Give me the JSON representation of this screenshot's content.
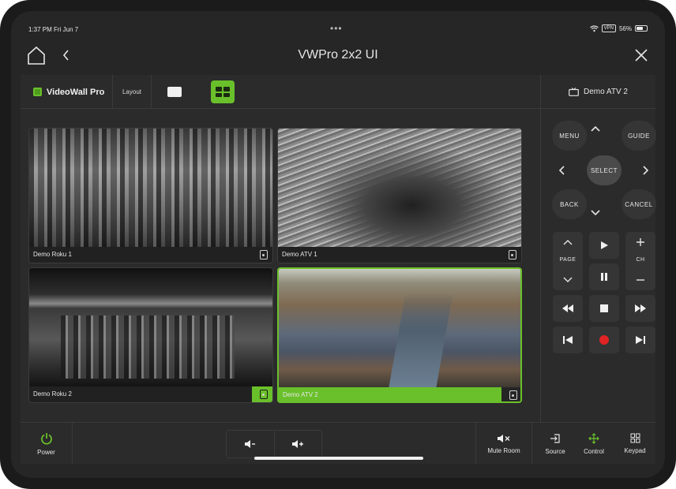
{
  "status": {
    "time": "1:37 PM   Fri Jun 7",
    "vpn": "VPN",
    "battery": "56%"
  },
  "titlebar": {
    "title": "VWPro 2x2 UI"
  },
  "topbar": {
    "brand": "VideoWall Pro",
    "layout_label": "Layout",
    "selected_device": "Demo ATV 2"
  },
  "tiles": [
    {
      "label": "Demo Roku 1"
    },
    {
      "label": "Demo ATV 1"
    },
    {
      "label": "Demo Roku 2"
    },
    {
      "label": "Demo ATV 2"
    }
  ],
  "remote": {
    "menu": "MENU",
    "guide": "GUIDE",
    "select": "SELECT",
    "back": "BACK",
    "cancel": "CANCEL",
    "page": "PAGE",
    "ch": "CH"
  },
  "bottombar": {
    "power": "Power",
    "mute": "Mute Room",
    "source": "Source",
    "control": "Control",
    "keypad": "Keypad"
  },
  "colors": {
    "accent": "#6ac02b",
    "background": "#2b2b2b"
  }
}
